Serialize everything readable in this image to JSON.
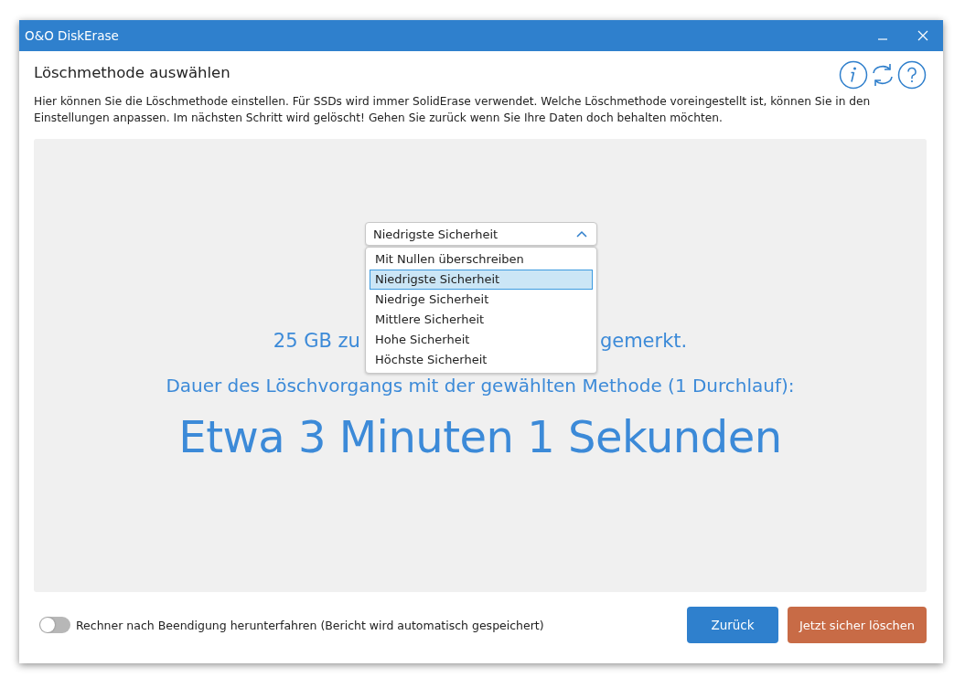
{
  "window": {
    "title": "O&O DiskErase"
  },
  "heading": "Löschmethode auswählen",
  "description": "Hier können Sie die Löschmethode einstellen. Für SSDs wird immer SolidErase verwendet. Welche Löschmethode voreingestellt ist, können Sie in den Einstellungen anpassen. Im nächsten Schritt wird gelöscht! Gehen Sie zurück wenn Sie Ihre Daten doch behalten möchten.",
  "method_dropdown": {
    "value": "Niedrigste Sicherheit",
    "expanded": true,
    "options": [
      {
        "label": "Mit Nullen überschreiben",
        "selected": false
      },
      {
        "label": "Niedrigste Sicherheit",
        "selected": true
      },
      {
        "label": "Niedrige Sicherheit",
        "selected": false
      },
      {
        "label": "Mittlere Sicherheit",
        "selected": false
      },
      {
        "label": "Hohe Sicherheit",
        "selected": false
      },
      {
        "label": "Höchste Sicherheit",
        "selected": false
      }
    ]
  },
  "summary": {
    "size_line_start": "25 GB zu",
    "size_line_end": "gemerkt.",
    "duration_label": "Dauer des Löschvorgangs mit der gewählten Methode (1 Durchlauf):",
    "duration": "Etwa 3 Minuten 1 Sekunden"
  },
  "shutdown_toggle": {
    "label": "Rechner nach Beendigung herunterfahren (Bericht wird automatisch gespeichert)",
    "on": false
  },
  "buttons": [
    {
      "label": "Zurück",
      "kind": "secondary"
    },
    {
      "label": "Jetzt sicher löschen",
      "kind": "danger"
    }
  ]
}
